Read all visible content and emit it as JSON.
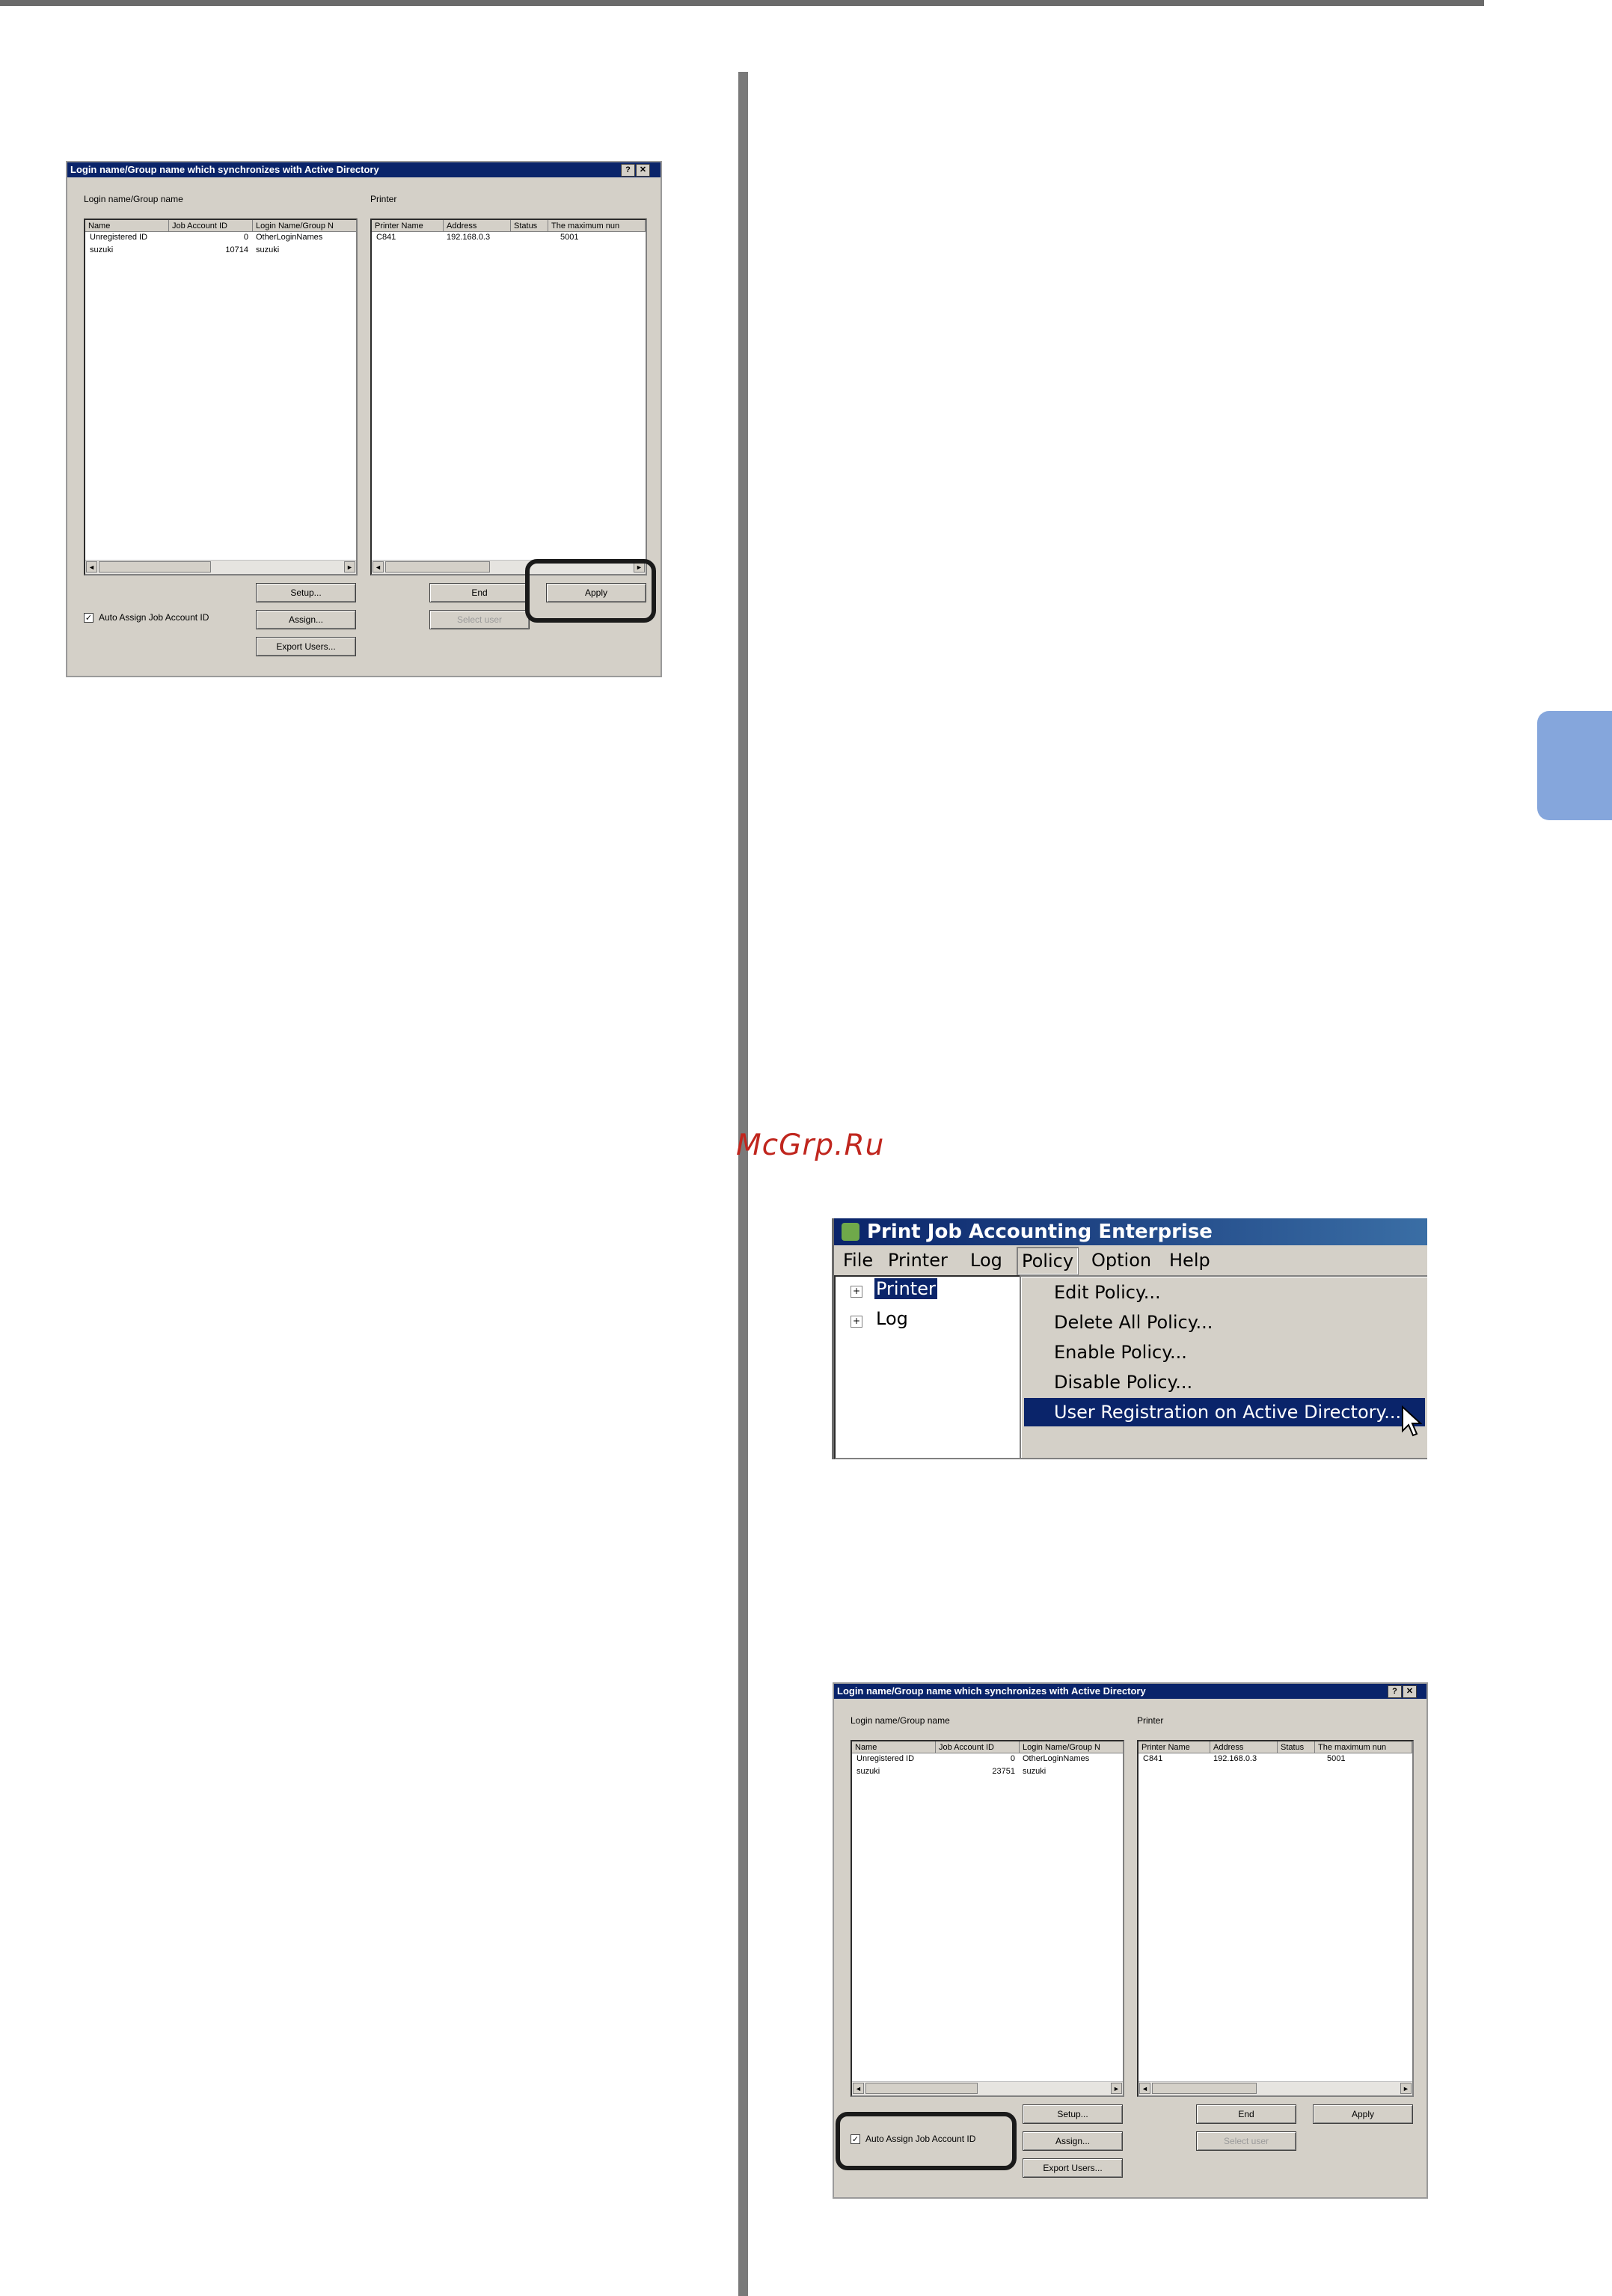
{
  "watermark": "McGrp.Ru",
  "dialog_top": {
    "title": "Login name/Group name which synchronizes with Active Directory",
    "help_btn": "?",
    "close_btn": "✕",
    "left_label": "Login name/Group name",
    "right_label": "Printer",
    "users_columns": [
      "Name",
      "Job Account ID",
      "Login Name/Group N"
    ],
    "users_rows": [
      {
        "name": "Unregistered ID",
        "id": "0",
        "login": "OtherLoginNames"
      },
      {
        "name": "suzuki",
        "id": "10714",
        "login": "suzuki"
      }
    ],
    "printer_columns": [
      "Printer Name",
      "Address",
      "Status",
      "The maximum nun"
    ],
    "printer_rows": [
      {
        "name": "C841",
        "address": "192.168.0.3",
        "status": "",
        "max": "5001"
      }
    ],
    "checkbox_label": "Auto Assign Job Account ID",
    "checkbox_mark": "✓",
    "setup": "Setup...",
    "assign": "Assign...",
    "export": "Export Users...",
    "end": "End",
    "apply": "Apply",
    "select_user": "Select user"
  },
  "menu_screenshot": {
    "app_title": "Print Job Accounting Enterprise",
    "menus": [
      "File",
      "Printer",
      "Log",
      "Policy",
      "Option",
      "Help"
    ],
    "tree": [
      "Printer",
      "Log"
    ],
    "plus": "+",
    "policy_items": [
      "Edit Policy...",
      "Delete All Policy...",
      "Enable Policy...",
      "Disable Policy...",
      "User Registration on Active Directory..."
    ]
  },
  "dialog_bottom": {
    "title": "Login name/Group name which synchronizes with Active Directory",
    "help_btn": "?",
    "close_btn": "✕",
    "left_label": "Login name/Group name",
    "right_label": "Printer",
    "users_columns": [
      "Name",
      "Job Account ID",
      "Login Name/Group N"
    ],
    "users_rows": [
      {
        "name": "Unregistered ID",
        "id": "0",
        "login": "OtherLoginNames"
      },
      {
        "name": "suzuki",
        "id": "23751",
        "login": "suzuki"
      }
    ],
    "printer_columns": [
      "Printer Name",
      "Address",
      "Status",
      "The maximum nun"
    ],
    "printer_rows": [
      {
        "name": "C841",
        "address": "192.168.0.3",
        "status": "",
        "max": "5001"
      }
    ],
    "checkbox_label": "Auto Assign Job Account ID",
    "checkbox_mark": "✓",
    "setup": "Setup...",
    "assign": "Assign...",
    "export": "Export Users...",
    "end": "End",
    "apply": "Apply",
    "select_user": "Select user"
  }
}
